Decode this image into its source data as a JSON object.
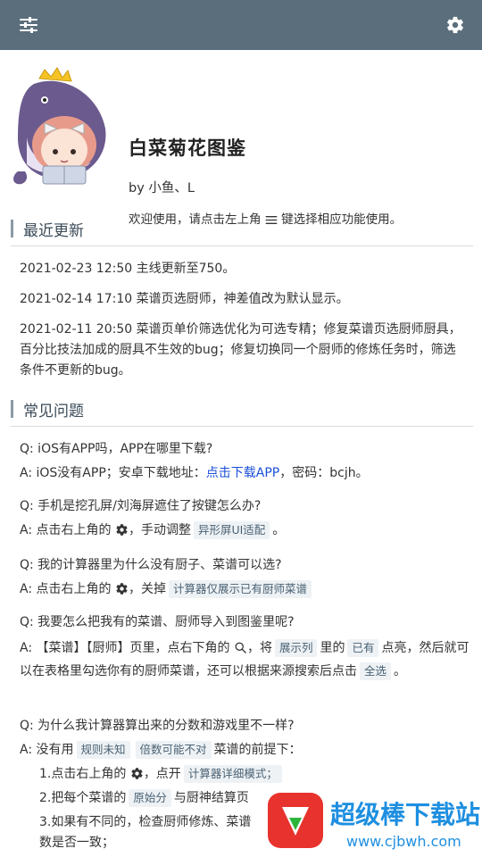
{
  "header": {
    "title": "白菜菊花图鉴",
    "author": "by 小鱼、L",
    "welcome_pre": "欢迎使用，请点击左上角",
    "welcome_post": "键选择相应功能使用。"
  },
  "icons": {
    "menu": "sliders-icon",
    "settings": "gear-icon",
    "search": "search-icon"
  },
  "recent": {
    "title": "最近更新",
    "items": [
      "2021-02-23 12:50 主线更新至750。",
      "2021-02-14 17:10 菜谱页选厨师，神差值改为默认显示。",
      "2021-02-11 20:50 菜谱页单价筛选优化为可选专精；修复菜谱页选厨师厨具，百分比技法加成的厨具不生效的bug；修复切换同一个厨师的修炼任务时，筛选条件不更新的bug。"
    ]
  },
  "faq": {
    "title": "常见问题",
    "q1": {
      "q": "Q: iOS有APP吗，APP在哪里下载?",
      "a_pre": "A: iOS没有APP；安卓下载地址：",
      "a_link": "点击下载APP",
      "a_post": "，密码：bcjh。"
    },
    "q2": {
      "q": "Q: 手机是挖孔屏/刘海屏遮住了按键怎么办?",
      "a_pre": "A: 点击右上角的",
      "a_mid": "，手动调整",
      "a_tag": "异形屏UI适配",
      "a_post": "。"
    },
    "q3": {
      "q": "Q: 我的计算器里为什么没有厨子、菜谱可以选?",
      "a_pre": "A: 点击右上角的",
      "a_mid": "，关掉",
      "a_tag": "计算器仅展示已有厨师菜谱"
    },
    "q4": {
      "q": "Q: 我要怎么把我有的菜谱、厨师导入到图鉴里呢?",
      "a_pre": "A: 【菜谱】【厨师】页里，点右下角的",
      "a_mid": "，将",
      "a_tag1": "展示列",
      "a_mid2": "里的",
      "a_tag2": "已有",
      "a_mid3": "点亮，然后就可以在表格里勾选你有的厨师菜谱，还可以根据来源搜索后点击",
      "a_tag3": "全选",
      "a_post": "。"
    },
    "q5": {
      "q": "Q: 为什么我计算器算出来的分数和游戏里不一样?",
      "a_pre": "A: 没有用",
      "a_tag1": "规则未知",
      "a_tag2": "倍数可能不对",
      "a_post": "菜谱的前提下：",
      "s1_pre": "1.点击右上角的",
      "s1_mid": "，点开",
      "s1_tag": "计算器详细模式；",
      "s2_pre": "2.把每个菜谱的",
      "s2_tag": "原始分",
      "s2_post": "与厨神结算页",
      "s3": "3.如果有不同的，检查厨师修炼、菜谱",
      "s3_tail": "数是否一致；"
    }
  },
  "watermark": {
    "text": "超级棒下载站",
    "url": "www.cjbwh.com"
  },
  "colors": {
    "topbar": "#5b6e7c",
    "link": "#1a4fd6",
    "tag_bg": "#eef2f5",
    "watermark_red": "#e8322d"
  }
}
